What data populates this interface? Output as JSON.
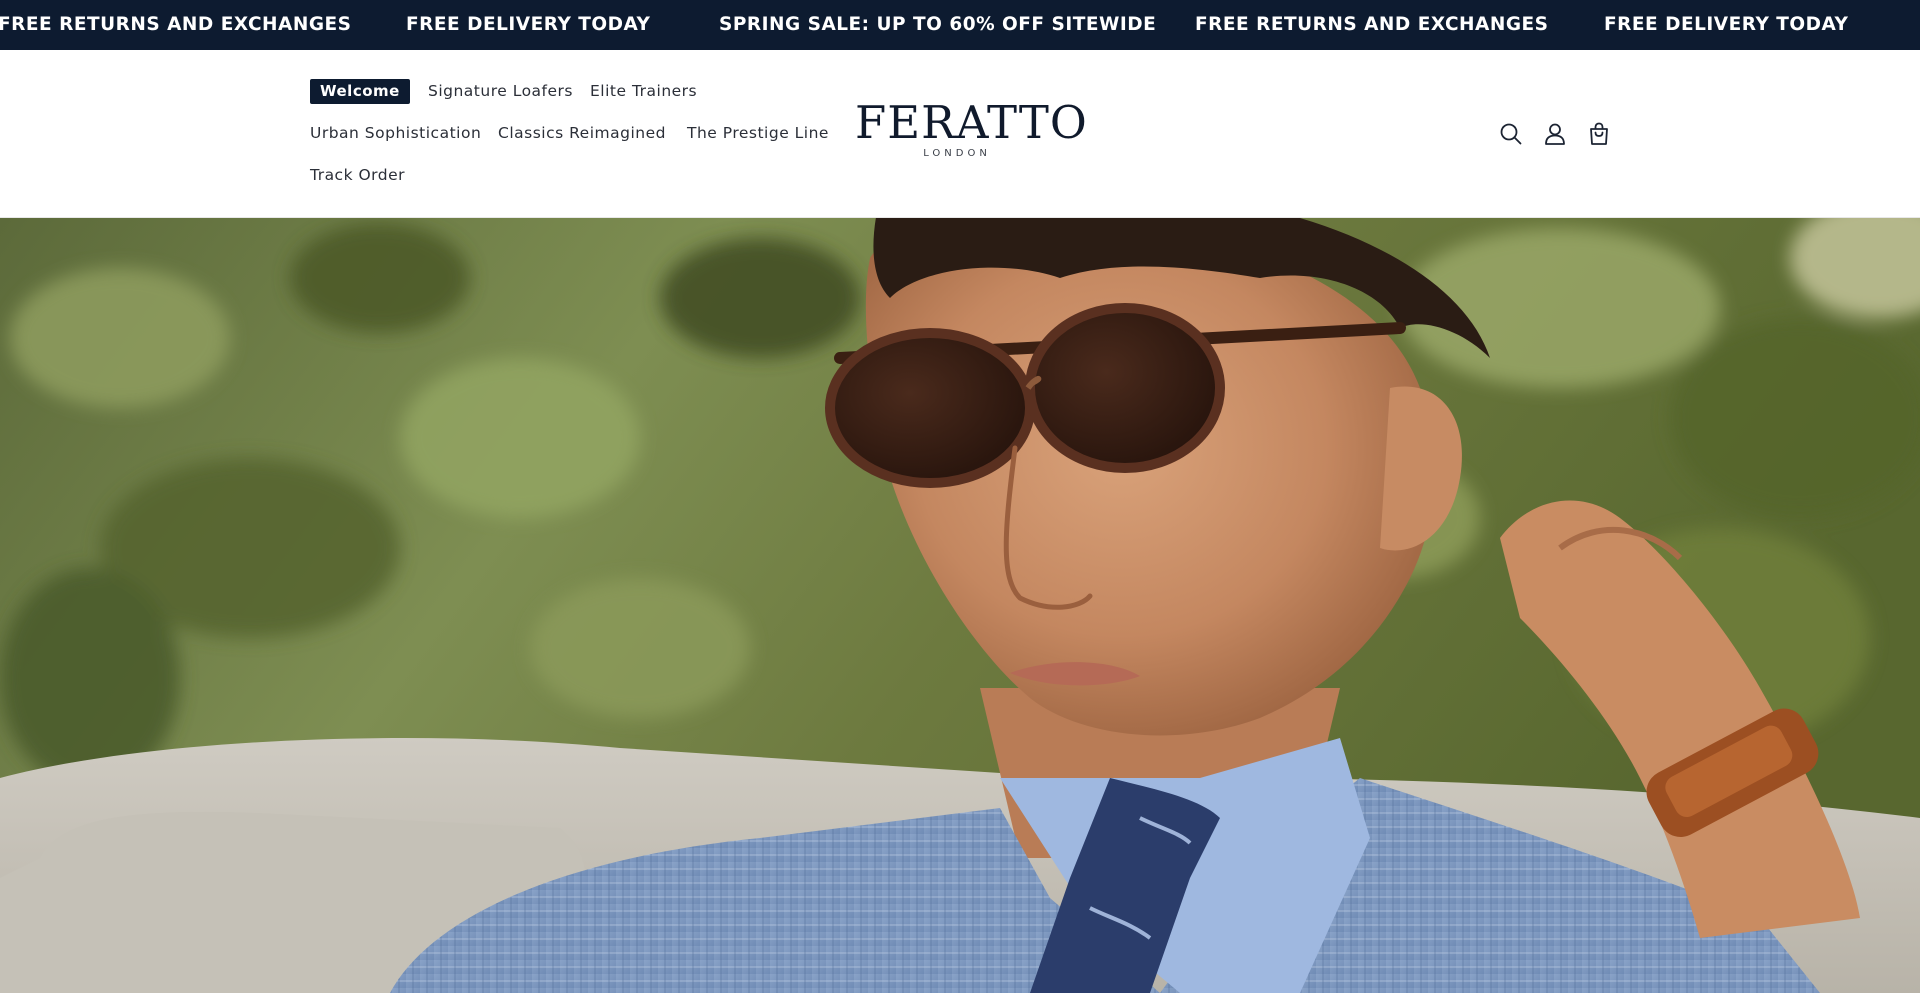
{
  "announcement": {
    "items": [
      "FREE RETURNS AND EXCHANGES",
      "FREE DELIVERY TODAY",
      "SPRING SALE: UP TO 60% OFF SITEWIDE",
      "FREE RETURNS AND EXCHANGES",
      "FREE DELIVERY TODAY"
    ],
    "background": "#0d1b30"
  },
  "nav": {
    "items": [
      {
        "label": "Welcome",
        "active": true
      },
      {
        "label": "Signature Loafers"
      },
      {
        "label": "Elite Trainers"
      },
      {
        "label": "Urban Sophistication"
      },
      {
        "label": "Classics Reimagined"
      },
      {
        "label": "The Prestige Line"
      },
      {
        "label": "Track Order"
      }
    ]
  },
  "logo": {
    "name": "FERATTO",
    "sub": "LONDON"
  },
  "header_icons": [
    "search-icon",
    "account-icon",
    "cart-icon"
  ],
  "colors": {
    "brand_navy": "#0d1b30",
    "nav_text": "#2b2f38"
  }
}
